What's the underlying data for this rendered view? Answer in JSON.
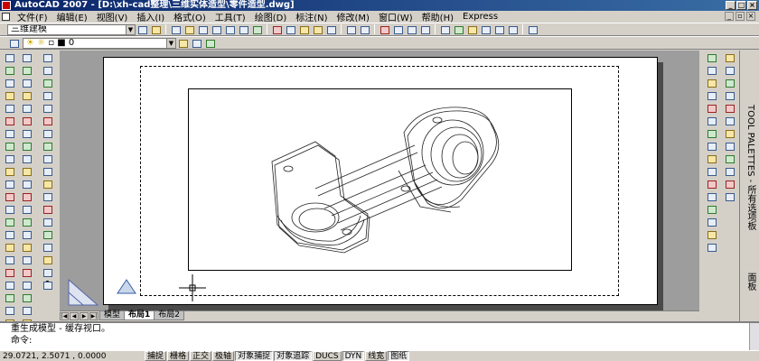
{
  "window": {
    "title": "AutoCAD 2007 - [D:\\xh-cad整理\\三维实体造型\\零件造型.dwg]",
    "controls": [
      "_",
      "□",
      "×"
    ]
  },
  "menu": {
    "items": [
      "文件(F)",
      "编辑(E)",
      "视图(V)",
      "插入(I)",
      "格式(O)",
      "工具(T)",
      "绘图(D)",
      "标注(N)",
      "修改(M)",
      "窗口(W)",
      "帮助(H)",
      "Express"
    ]
  },
  "toolbar": {
    "workspace": "三维建模",
    "layer": "0"
  },
  "layout_tabs": {
    "nav": [
      "|◀",
      "◀",
      "▶",
      "▶|"
    ],
    "tabs": [
      "模型",
      "布局1",
      "布局2"
    ],
    "active": "布局1"
  },
  "command": {
    "history": "重生成模型 - 缓存视口。",
    "prompt": "命令:"
  },
  "status": {
    "coordinates": "29.0721, 2.5071 , 0.0000",
    "buttons": [
      "捕捉",
      "栅格",
      "正交",
      "极轴",
      "对象捕捉",
      "对象追踪",
      "DUCS",
      "DYN",
      "线宽",
      "图纸"
    ],
    "active_buttons": [
      "对象捕捉",
      "对象追踪",
      "DYN",
      "图纸"
    ]
  },
  "tool_palette": {
    "title": "TOOL PALETTES - 所有选项板",
    "section": "面板"
  }
}
